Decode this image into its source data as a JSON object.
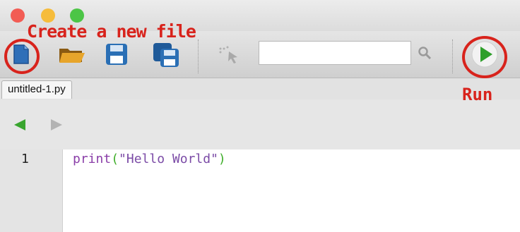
{
  "annotations": {
    "create_new_file": "Create a new file",
    "run": "Run"
  },
  "toolbar": {
    "buttons": [
      {
        "name": "new-file",
        "icon": "file-icon"
      },
      {
        "name": "open",
        "icon": "folder-icon"
      },
      {
        "name": "save",
        "icon": "floppy-icon"
      },
      {
        "name": "save-all",
        "icon": "floppy-stack-icon"
      },
      {
        "name": "select-tool",
        "icon": "cursor-icon"
      },
      {
        "name": "search",
        "icon": "search-icon"
      },
      {
        "name": "run",
        "icon": "play-icon"
      }
    ],
    "search_value": ""
  },
  "tabs": [
    {
      "label": "untitled-1.py"
    }
  ],
  "navigation": {
    "back_icon": "arrow-left-icon",
    "forward_icon": "arrow-right-icon"
  },
  "editor": {
    "line_number": "1",
    "code": {
      "fn": "print",
      "open": "(",
      "string": "\"Hello World\"",
      "close": ")"
    }
  },
  "colors": {
    "annotation": "#d8231c",
    "accent_green": "#2e9f2a",
    "file_blue": "#2f6fb8"
  }
}
